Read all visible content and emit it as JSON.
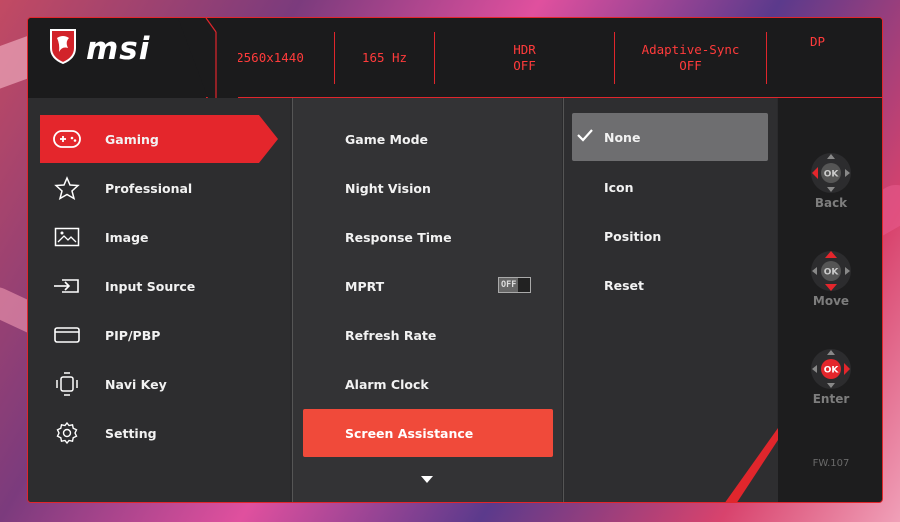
{
  "brand": {
    "name": "msi"
  },
  "status": [
    {
      "line1": "2560x1440",
      "line2": ""
    },
    {
      "line1": "165 Hz",
      "line2": ""
    },
    {
      "line1": "HDR",
      "line2": "OFF"
    },
    {
      "line1": "Adaptive-Sync",
      "line2": "OFF"
    },
    {
      "line1": "DP",
      "line2": ""
    }
  ],
  "main_menu": [
    {
      "label": "Gaming",
      "icon": "gamepad-icon",
      "active": true
    },
    {
      "label": "Professional",
      "icon": "star-icon",
      "active": false
    },
    {
      "label": "Image",
      "icon": "image-icon",
      "active": false
    },
    {
      "label": "Input Source",
      "icon": "input-source-icon",
      "active": false
    },
    {
      "label": "PIP/PBP",
      "icon": "pip-icon",
      "active": false
    },
    {
      "label": "Navi Key",
      "icon": "navi-key-icon",
      "active": false
    },
    {
      "label": "Setting",
      "icon": "gear-icon",
      "active": false
    }
  ],
  "sub_menu": [
    {
      "label": "Game Mode"
    },
    {
      "label": "Night Vision"
    },
    {
      "label": "Response Time"
    },
    {
      "label": "MPRT",
      "toggle": "OFF"
    },
    {
      "label": "Refresh Rate"
    },
    {
      "label": "Alarm Clock"
    },
    {
      "label": "Screen Assistance",
      "active": true
    }
  ],
  "options": [
    {
      "label": "None",
      "selected": true
    },
    {
      "label": "Icon"
    },
    {
      "label": "Position"
    },
    {
      "label": "Reset"
    }
  ],
  "nav_keys": [
    {
      "label": "Back",
      "center": "OK"
    },
    {
      "label": "Move",
      "center": "OK"
    },
    {
      "label": "Enter",
      "center": "OK"
    }
  ],
  "firmware": "FW.107",
  "colors": {
    "accent": "#e4262c",
    "highlight": "#f04a3a",
    "selected_option": "#6e6e70"
  }
}
